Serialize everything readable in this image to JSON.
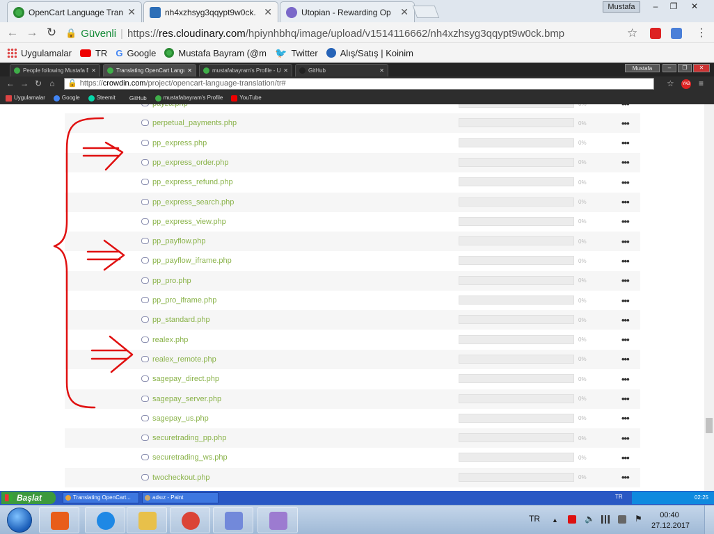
{
  "outer_browser": {
    "tabs": [
      {
        "title": "OpenCart Language Tran",
        "active": false,
        "favicon": "crowdin-icon"
      },
      {
        "title": "nh4xzhsyg3qqypt9w0ck.",
        "active": true,
        "favicon": "cloudinary-icon"
      },
      {
        "title": "Utopian - Rewarding Op",
        "active": false,
        "favicon": "utopian-icon"
      }
    ],
    "profile": "Mustafa",
    "window_controls": {
      "minimize": "‒",
      "maximize": "❐",
      "close": "✕"
    },
    "secure_label": "Güvenli",
    "url_scheme": "https://",
    "url_host": "res.cloudinary.com",
    "url_path": "/hpiynhbhq/image/upload/v1514116662/nh4xzhsyg3qqypt9w0ck.bmp",
    "bookmarks": [
      {
        "label": "Uygulamalar",
        "icon": "apps-icon"
      },
      {
        "label": "TR",
        "icon": "youtube-icon"
      },
      {
        "label": "Google",
        "icon": "google-icon"
      },
      {
        "label": "Mustafa Bayram (@m",
        "icon": "steemit-icon"
      },
      {
        "label": "Twitter",
        "icon": "twitter-icon"
      },
      {
        "label": "Alış/Satış | Koinim",
        "icon": "koinim-icon"
      }
    ]
  },
  "inner_browser": {
    "tabs": [
      {
        "title": "People following Mustafa Ba",
        "active": false
      },
      {
        "title": "Translating OpenCart Langu",
        "active": true
      },
      {
        "title": "mustafabayram's Profile - Ut",
        "active": false
      },
      {
        "title": "GitHub",
        "active": false
      }
    ],
    "profile": "Mustafa",
    "url_scheme": "https://",
    "url_host": "crowdin.com",
    "url_path": "/project/opencart-language-translation/tr#",
    "ext_badge": "YAB",
    "bookmarks": [
      {
        "label": "Uygulamalar",
        "color": "#d44"
      },
      {
        "label": "Google",
        "color": "#4285f4"
      },
      {
        "label": "Steemit",
        "color": "#06d6a9"
      },
      {
        "label": "GitHub",
        "color": "#333"
      },
      {
        "label": "mustafabayram's Profile",
        "color": "#3fae49"
      },
      {
        "label": "YouTube",
        "color": "#e00"
      }
    ]
  },
  "files": [
    {
      "name": "payza.php",
      "percent": "0%"
    },
    {
      "name": "perpetual_payments.php",
      "percent": "0%"
    },
    {
      "name": "pp_express.php",
      "percent": "0%"
    },
    {
      "name": "pp_express_order.php",
      "percent": "0%"
    },
    {
      "name": "pp_express_refund.php",
      "percent": "0%"
    },
    {
      "name": "pp_express_search.php",
      "percent": "0%"
    },
    {
      "name": "pp_express_view.php",
      "percent": "0%"
    },
    {
      "name": "pp_payflow.php",
      "percent": "0%"
    },
    {
      "name": "pp_payflow_iframe.php",
      "percent": "0%"
    },
    {
      "name": "pp_pro.php",
      "percent": "0%"
    },
    {
      "name": "pp_pro_iframe.php",
      "percent": "0%"
    },
    {
      "name": "pp_standard.php",
      "percent": "0%"
    },
    {
      "name": "realex.php",
      "percent": "0%"
    },
    {
      "name": "realex_remote.php",
      "percent": "0%"
    },
    {
      "name": "sagepay_direct.php",
      "percent": "0%"
    },
    {
      "name": "sagepay_server.php",
      "percent": "0%"
    },
    {
      "name": "sagepay_us.php",
      "percent": "0%"
    },
    {
      "name": "securetrading_pp.php",
      "percent": "0%"
    },
    {
      "name": "securetrading_ws.php",
      "percent": "0%"
    },
    {
      "name": "twocheckout.php",
      "percent": "0%"
    }
  ],
  "row_menu_glyph": "•••",
  "xp_taskbar": {
    "start_label": "Başlat",
    "tasks": [
      "Translating OpenCart...",
      "adsız - Paint"
    ],
    "lang": "TR",
    "time": "02:25"
  },
  "win7_taskbar": {
    "lang": "TR",
    "time": "00:40",
    "date": "27.12.2017",
    "pinned": [
      {
        "app": "media-player-icon",
        "color": "#e85d1a"
      },
      {
        "app": "internet-explorer-icon",
        "color": "#1e88e5"
      },
      {
        "app": "file-explorer-icon",
        "color": "#e8c04a"
      },
      {
        "app": "chrome-icon",
        "color": "#db4437"
      },
      {
        "app": "discord-icon",
        "color": "#7289da"
      },
      {
        "app": "paint-icon",
        "color": "#9c7bd0"
      }
    ]
  }
}
